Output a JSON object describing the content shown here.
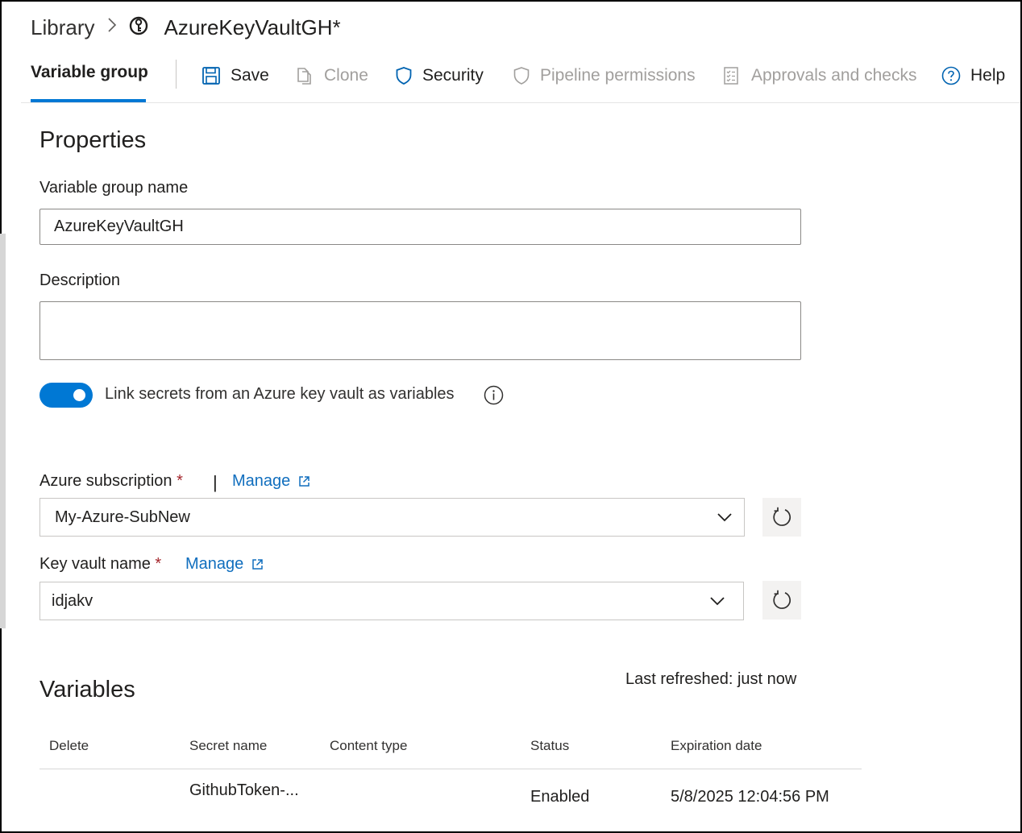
{
  "header": {
    "breadcrumb_root": "Library",
    "breadcrumb_separator": ">",
    "group_icon": "variable-group-icon",
    "title": "AzureKeyVaultGH*"
  },
  "toolbar": {
    "active_tab": "Variable group",
    "save": "Save",
    "clone": "Clone",
    "security": "Security",
    "pipeline_permissions": "Pipeline permissions",
    "approvals": "Approvals and checks",
    "help": "Help",
    "accent_color": "#0078d4"
  },
  "properties": {
    "heading": "Properties",
    "name_label": "Variable group name",
    "name_value": "AzureKeyVaultGH",
    "description_label": "Description",
    "description_value": "",
    "toggle_label": "Link secrets from an Azure key vault as variables",
    "toggle_on": true
  },
  "subscription": {
    "label": "Azure subscription",
    "required_mark": "*",
    "divider": "|",
    "manage_label": "Manage",
    "selected": "My-Azure-SubNew"
  },
  "keyvault": {
    "label": "Key vault name",
    "required_mark": "*",
    "manage_label": "Manage",
    "selected": "idjakv"
  },
  "variables": {
    "heading": "Variables",
    "last_refreshed": "Last refreshed: just now",
    "columns": [
      "Delete",
      "Secret name",
      "Content type",
      "Status",
      "Expiration date"
    ],
    "rows": [
      {
        "delete": "",
        "secret_name": "GithubToken-...",
        "content_type": "",
        "status": "Enabled",
        "expiration": "5/8/2025 12:04:56 PM"
      }
    ]
  }
}
